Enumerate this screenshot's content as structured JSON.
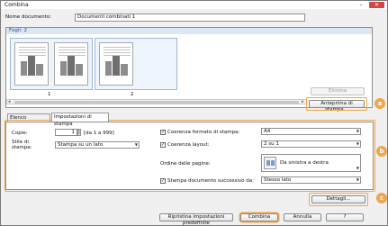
{
  "window": {
    "title": "Combina",
    "minimize_icon": "minimize-icon",
    "close_icon": "close-icon",
    "close_glyph": "✕",
    "minimize_glyph": "–"
  },
  "doc": {
    "name_label": "Nome documento:",
    "name_value": "Documenti combinati 1"
  },
  "sheets": {
    "header": "Fogli: 2",
    "page_numbers": [
      "1",
      "2"
    ],
    "remove_button": "Elimina",
    "preview_button": "Anteprima di stampa..."
  },
  "tabs": [
    "Elenco documenti",
    "Impostazioni di stampa"
  ],
  "print_settings": {
    "copies_label": "Copie:",
    "copies_value": "1",
    "copies_range": "[da 1 a 999]",
    "style_label": "Stile di stampa:",
    "style_value": "Stampa su un lato",
    "format_check_label": "Coerenza formato di stampa:",
    "format_value": "A4",
    "layout_check_label": "Coerenza layout:",
    "layout_value": "2 su 1",
    "page_order_label": "Ordine delle pagine:",
    "page_order_value": "Da sinistra a destra",
    "next_doc_check_label": "Stampa documento successivo da:",
    "next_doc_value": "Stesso lato",
    "check_mark": "✓"
  },
  "details_button": "Dettagli...",
  "footer": {
    "reset_button": "Ripristina impostazioni predefinite",
    "combine_button": "Combina",
    "cancel_button": "Annulla",
    "help_button": "?"
  },
  "callouts": [
    "a",
    "b",
    "c"
  ],
  "colors": {
    "accent": "#f0a64c",
    "header_bg": "#dbe7f5",
    "close_red": "#d64545"
  }
}
